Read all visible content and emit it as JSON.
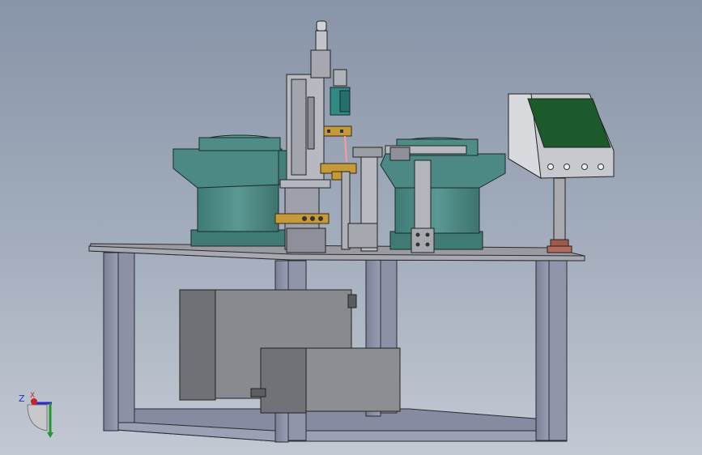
{
  "viewport": {
    "kind": "cad-3d-view"
  },
  "axis_triad": {
    "z_label": "Z",
    "x_label": "X",
    "y_label": ""
  },
  "hmi_panel": {
    "screen_color": "#1c5a2c",
    "button_count": 4
  },
  "colors": {
    "frame": "#8a8fa6",
    "bowl": "#4e8a85",
    "cabinet": "#7d7f84",
    "brass": "#c49a3a",
    "plate": "#9a9aa0",
    "post": "#a8aab0",
    "base_mount": "#a05a4a"
  }
}
